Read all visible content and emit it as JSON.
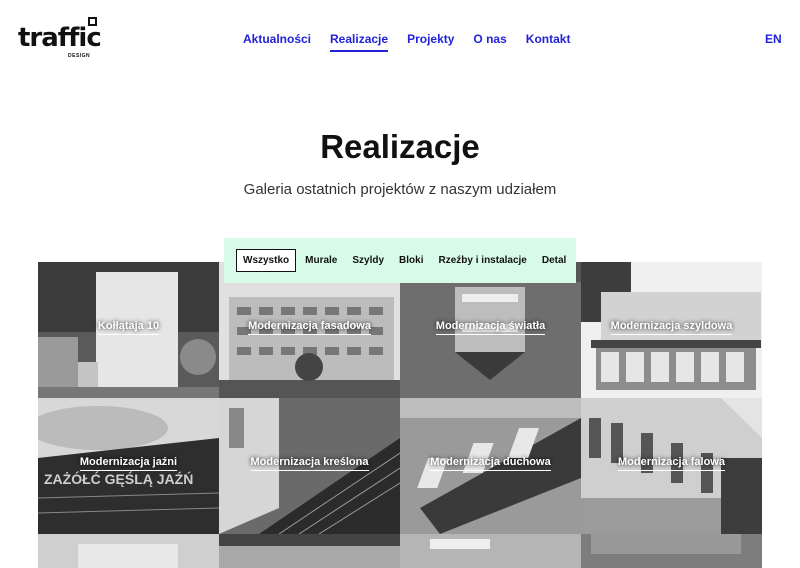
{
  "logo": {
    "word": "traffic",
    "sub": "DESIGN"
  },
  "nav": {
    "items": [
      {
        "label": "Aktualności"
      },
      {
        "label": "Realizacje"
      },
      {
        "label": "Projekty"
      },
      {
        "label": "O nas"
      },
      {
        "label": "Kontakt"
      }
    ],
    "active_index": 1,
    "lang": "EN"
  },
  "colors": {
    "accent": "#2222d6",
    "filter_bg": "#d8fbe9"
  },
  "hero": {
    "title": "Realizacje",
    "subtitle": "Galeria ostatnich projektów z naszym udziałem"
  },
  "filters": {
    "items": [
      "Wszystko",
      "Murale",
      "Szyldy",
      "Bloki",
      "Rzeźby i instalacje",
      "Detal"
    ],
    "active_index": 0
  },
  "gallery": {
    "tiles": [
      {
        "label": "Kołłątaja 10"
      },
      {
        "label": "Modernizacja fasadowa"
      },
      {
        "label": "Modernizacja światła"
      },
      {
        "label": "Modernizacja szyldowa"
      },
      {
        "label": "Modernizacja jaźni"
      },
      {
        "label": "Modernizacja kreślona"
      },
      {
        "label": "Modernizacja duchowa"
      },
      {
        "label": "Modernizacja falowa"
      }
    ],
    "image_texts": {
      "tile5_sign": "ZAŻÓŁĆ GĘŚLĄ JAŹŃ"
    }
  }
}
